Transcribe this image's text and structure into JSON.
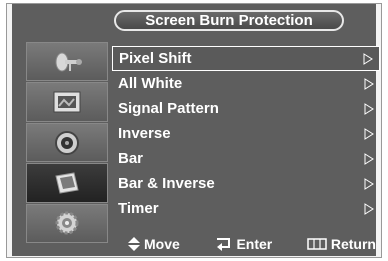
{
  "header": {
    "title": "Screen Burn Protection"
  },
  "sidebar": {
    "items": [
      {
        "icon": "satellite-dish-icon",
        "active": false
      },
      {
        "icon": "picture-icon",
        "active": false
      },
      {
        "icon": "speaker-icon",
        "active": false
      },
      {
        "icon": "setup-icon",
        "active": true
      },
      {
        "icon": "gear-icon",
        "active": false
      }
    ]
  },
  "menu": {
    "items": [
      {
        "label": "Pixel Shift",
        "selected": true
      },
      {
        "label": "All White"
      },
      {
        "label": "Signal Pattern"
      },
      {
        "label": "Inverse"
      },
      {
        "label": "Bar"
      },
      {
        "label": "Bar & Inverse"
      },
      {
        "label": "Timer"
      }
    ]
  },
  "footer": {
    "move_label": "Move",
    "enter_label": "Enter",
    "return_label": "Return"
  },
  "colors": {
    "panel": "#5e5e5e",
    "text": "#ffffff",
    "frame": "#f4f4f4"
  }
}
